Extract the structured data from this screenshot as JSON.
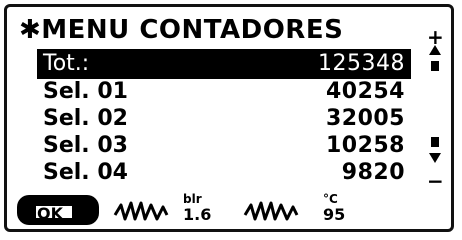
{
  "menu": {
    "title": "✱MENU CONTADORES"
  },
  "rows": [
    {
      "label": "Tot.:",
      "value": "125348",
      "selected": true
    },
    {
      "label": "Sel. 01",
      "value": "40254"
    },
    {
      "label": "Sel. 02",
      "value": "32005"
    },
    {
      "label": "Sel. 03",
      "value": "10258"
    },
    {
      "label": "Sel. 04",
      "value": "9820"
    }
  ],
  "scrollbar": {
    "plus": "+",
    "minus": "−"
  },
  "function_bar": {
    "ok_label": "OK",
    "blr_top": "blr",
    "blr_bottom": "1.6",
    "temp_top": "°C",
    "temp_bottom": "95"
  }
}
